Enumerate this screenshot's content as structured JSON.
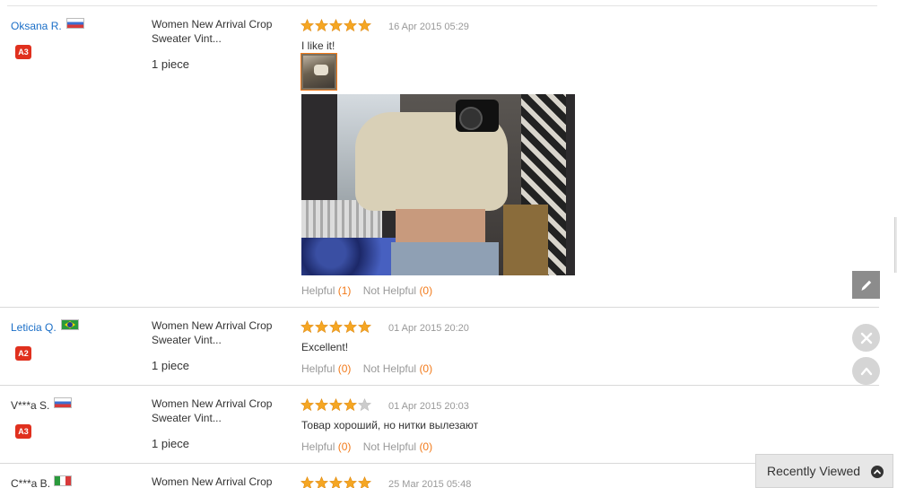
{
  "colors": {
    "link": "#1a6ec7",
    "star": "#f5a623",
    "star_empty": "#cccccc",
    "accent": "#f27a1a",
    "badge": "#e0301e"
  },
  "reviews": [
    {
      "buyer": "Oksana R.",
      "flag": "russia-flag",
      "level": "A3",
      "product_title": "Women New Arrival Crop Sweater Vint...",
      "quantity": "1 piece",
      "rating": 5,
      "date": "16 Apr 2015 05:29",
      "text": "I like it!",
      "helpful_label": "Helpful",
      "helpful_count": "(1)",
      "not_helpful_label": "Not Helpful",
      "not_helpful_count": "(0)"
    },
    {
      "buyer": "Leticia Q.",
      "flag": "brazil-flag",
      "level": "A2",
      "product_title": "Women New Arrival Crop Sweater Vint...",
      "quantity": "1 piece",
      "rating": 5,
      "date": "01 Apr 2015 20:20",
      "text": "Excellent!",
      "helpful_label": "Helpful",
      "helpful_count": "(0)",
      "not_helpful_label": "Not Helpful",
      "not_helpful_count": "(0)"
    },
    {
      "buyer": "V***a S.",
      "flag": "russia-flag",
      "level": "A3",
      "product_title": "Women New Arrival Crop Sweater Vint...",
      "quantity": "1 piece",
      "rating": 4,
      "date": "01 Apr 2015 20:03",
      "text": "Товар хороший, но нитки вылезают",
      "helpful_label": "Helpful",
      "helpful_count": "(0)",
      "not_helpful_label": "Not Helpful",
      "not_helpful_count": "(0)"
    },
    {
      "buyer": "C***a B.",
      "flag": "italy-flag",
      "product_title": "Women New Arrival Crop",
      "rating": 5,
      "date": "25 Mar 2015 05:48"
    }
  ],
  "recently_viewed": {
    "label": "Recently Viewed",
    "icon": "chevron-up-circle-icon"
  },
  "side_controls": {
    "edit_icon": "pencil-icon",
    "close_icon": "close-icon",
    "up_icon": "chevron-up-icon"
  }
}
